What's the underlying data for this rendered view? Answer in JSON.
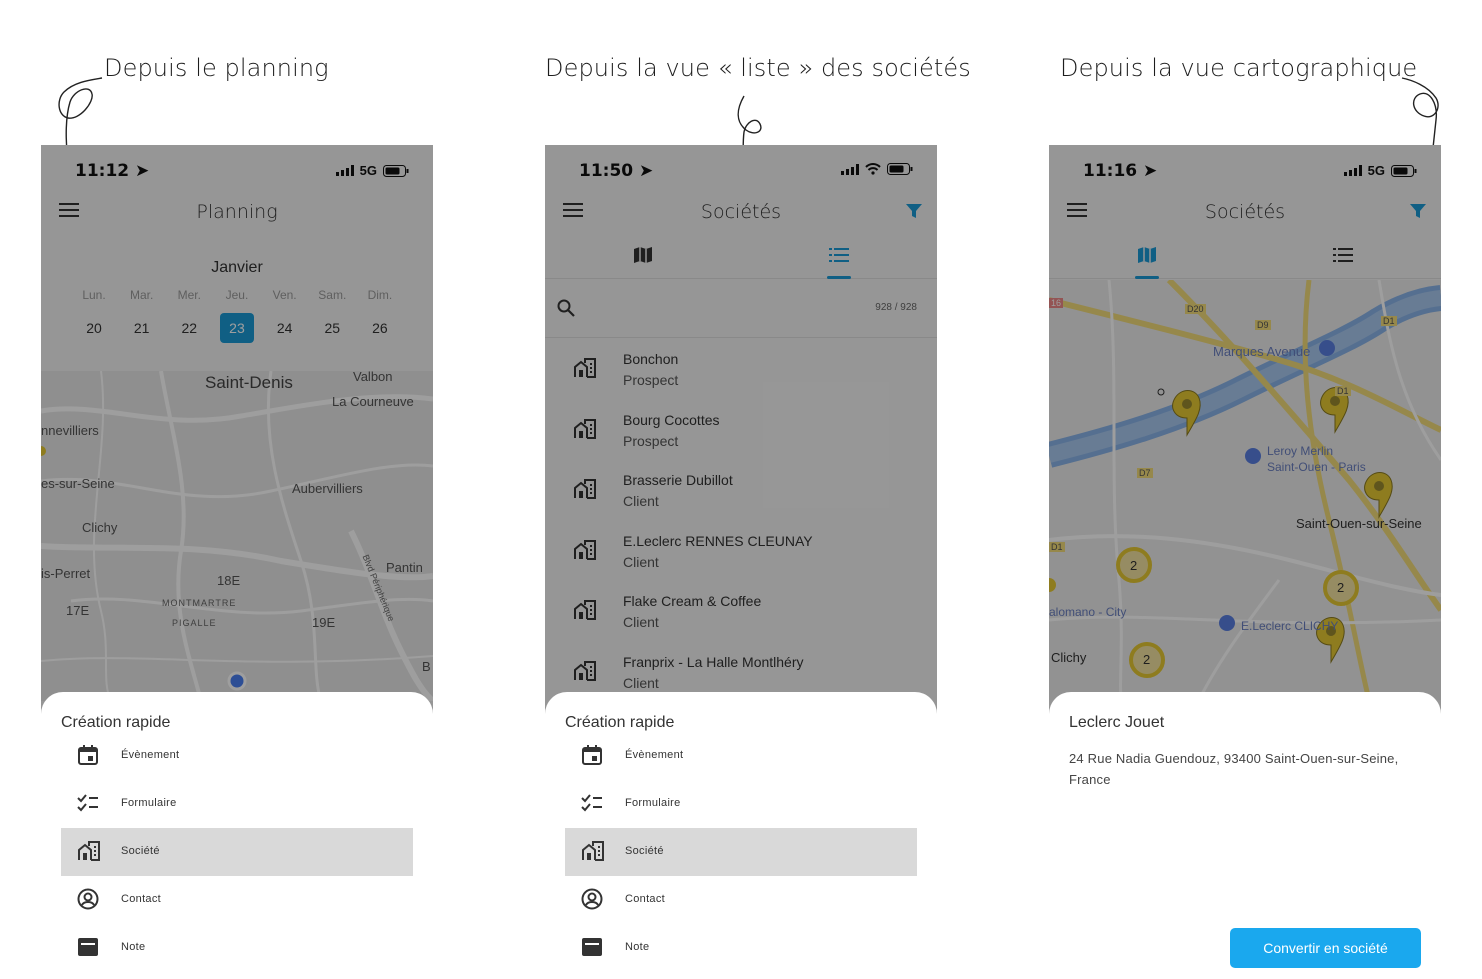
{
  "captions": {
    "left": "Depuis le planning",
    "middle": "Depuis la vue « liste » des sociétés",
    "right": "Depuis la vue cartographique"
  },
  "colors": {
    "accent": "#1a9ad6",
    "button": "#1aa8ee",
    "pin": "#e6c832"
  },
  "phone1": {
    "status": {
      "time": "11:12",
      "network": "5G"
    },
    "title": "Planning",
    "calendar": {
      "month": "Janvier",
      "days": [
        "Lun.",
        "Mar.",
        "Mer.",
        "Jeu.",
        "Ven.",
        "Sam.",
        "Dim."
      ],
      "dates": [
        "20",
        "21",
        "22",
        "23",
        "24",
        "25",
        "26"
      ],
      "selected_index": 3
    },
    "map_labels": {
      "saint_denis": "Saint-Denis",
      "valbon": "Valbon",
      "la_courneuve": "La Courneuve",
      "villiers": "nnevilliers",
      "seine": "es-sur-Seine",
      "aubervilliers": "Aubervilliers",
      "clichy": "Clichy",
      "perret": "is-Perret",
      "pantin": "Pantin",
      "e18": "18E",
      "montmartre": "MONTMARTRE",
      "pigalle": "PIGALLE",
      "e17": "17E",
      "e19": "19E",
      "boulevard": "Blvd Périphérique",
      "b": "B"
    },
    "sheet": {
      "title": "Création rapide",
      "options": [
        "Évènement",
        "Formulaire",
        "Société",
        "Contact",
        "Note"
      ],
      "selected": 2
    }
  },
  "phone2": {
    "status": {
      "time": "11:50"
    },
    "title": "Sociétés",
    "count": "928 / 928",
    "companies": [
      {
        "name": "Bonchon",
        "status": "Prospect"
      },
      {
        "name": "Bourg Cocottes",
        "status": "Prospect"
      },
      {
        "name": "Brasserie Dubillot",
        "status": "Client"
      },
      {
        "name": "E.Leclerc RENNES CLEUNAY",
        "status": "Client"
      },
      {
        "name": "Flake Cream & Coffee",
        "status": "Client"
      },
      {
        "name": "Franprix - La Halle Montlhéry",
        "status": "Client"
      }
    ],
    "sheet": {
      "title": "Création rapide",
      "options": [
        "Évènement",
        "Formulaire",
        "Société",
        "Contact",
        "Note"
      ],
      "selected": 2
    }
  },
  "phone3": {
    "status": {
      "time": "11:16",
      "network": "5G"
    },
    "title": "Sociétés",
    "map_labels": {
      "marques": "Marques Avenue",
      "leroy1": "Leroy Merlin",
      "leroy2": "Saint-Ouen - Paris",
      "saint_ouen": "Saint-Ouen-sur-Seine",
      "palomano": "alomano - City",
      "leclerc": "E.Leclerc CLICHY",
      "clichy": "Clichy",
      "d20": "D20",
      "d9": "D9",
      "d1": "D1",
      "d1b": "D1",
      "d7": "D7",
      "d1c": "D1",
      "r16": "16",
      "cluster1": "2",
      "cluster2": "2",
      "cluster3": "2"
    },
    "sheet": {
      "title": "Leclerc Jouet",
      "address": "24 Rue Nadia Guendouz, 93400 Saint-Ouen-sur-Seine, France",
      "button": "Convertir en société"
    }
  }
}
